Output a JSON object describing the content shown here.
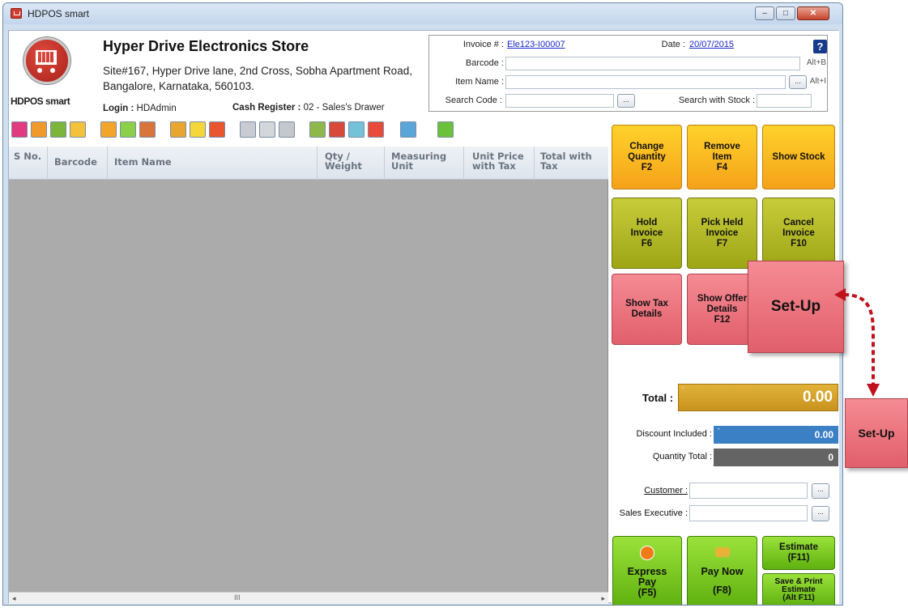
{
  "window": {
    "title": "HDPOS smart",
    "minimize": "–",
    "maximize": "□",
    "close": "✕"
  },
  "store": {
    "logo_text": "HDPOS smart",
    "name": "Hyper Drive Electronics Store",
    "address": "Site#167, Hyper Drive lane, 2nd Cross, Sobha Apartment Road, Bangalore, Karnataka, 560103.",
    "login_label": "Login :",
    "login_value": "HDAdmin",
    "cash_label": "Cash Register :",
    "cash_value": "02 - Sales's Drawer"
  },
  "invoice": {
    "invoice_label": "Invoice # :",
    "invoice_value": "Ele123-I00007",
    "date_label": "Date :",
    "date_value": "20/07/2015",
    "help": "?",
    "barcode_label": "Barcode :",
    "barcode_shortcut": "Alt+B",
    "item_label": "Item Name :",
    "item_shortcut": "Alt+I",
    "search_code_label": "Search Code :",
    "search_stock_label": "Search with Stock :",
    "browse": "..."
  },
  "grid": {
    "columns": [
      "S No.",
      "Barcode",
      "Item Name",
      "Qty / Weight",
      "Measuring Unit",
      "Unit Price with Tax",
      "Total with Tax"
    ],
    "rows": []
  },
  "functions": {
    "change_qty": [
      "Change",
      "Quantity",
      "F2"
    ],
    "remove_item": [
      "Remove",
      "Item",
      "F4"
    ],
    "show_stock": [
      "Show Stock"
    ],
    "hold_invoice": [
      "Hold",
      "Invoice",
      "F6"
    ],
    "pick_held": [
      "Pick Held",
      "Invoice",
      "F7"
    ],
    "cancel_invoice": [
      "Cancel",
      "Invoice",
      "F10"
    ],
    "show_tax": [
      "Show Tax",
      "Details"
    ],
    "show_offer": [
      "Show Offer",
      "Details",
      "F12"
    ]
  },
  "totals": {
    "total_label": "Total :",
    "total_value": "0.00",
    "discount_label": "Discount Included :",
    "discount_value": "0.00",
    "quantity_label": "Quantity Total :",
    "quantity_value": "0",
    "currency_tick": "`"
  },
  "customer": {
    "customer_label": "Customer :",
    "sales_exec_label": "Sales Executive :"
  },
  "payment": {
    "express": [
      "Express",
      "Pay",
      "(F5)"
    ],
    "pay_now": [
      "Pay Now",
      "(F8)"
    ],
    "estimate": [
      "Estimate",
      "(F11)"
    ],
    "save_print": [
      "Save & Print",
      "Estimate",
      "(Alt F11)"
    ]
  },
  "callouts": {
    "setup_large": "Set-Up",
    "setup_small": "Set-Up"
  },
  "scrollbar": {
    "left": "◂",
    "right": "▸",
    "thumb": "III"
  },
  "colors": {
    "accent_orange": "#f5a21a",
    "accent_olive": "#9ea616",
    "accent_pink": "#e15f6c",
    "accent_green": "#5fb10f",
    "total_gold": "#c8931c",
    "discount_blue": "#3b7fc4"
  }
}
